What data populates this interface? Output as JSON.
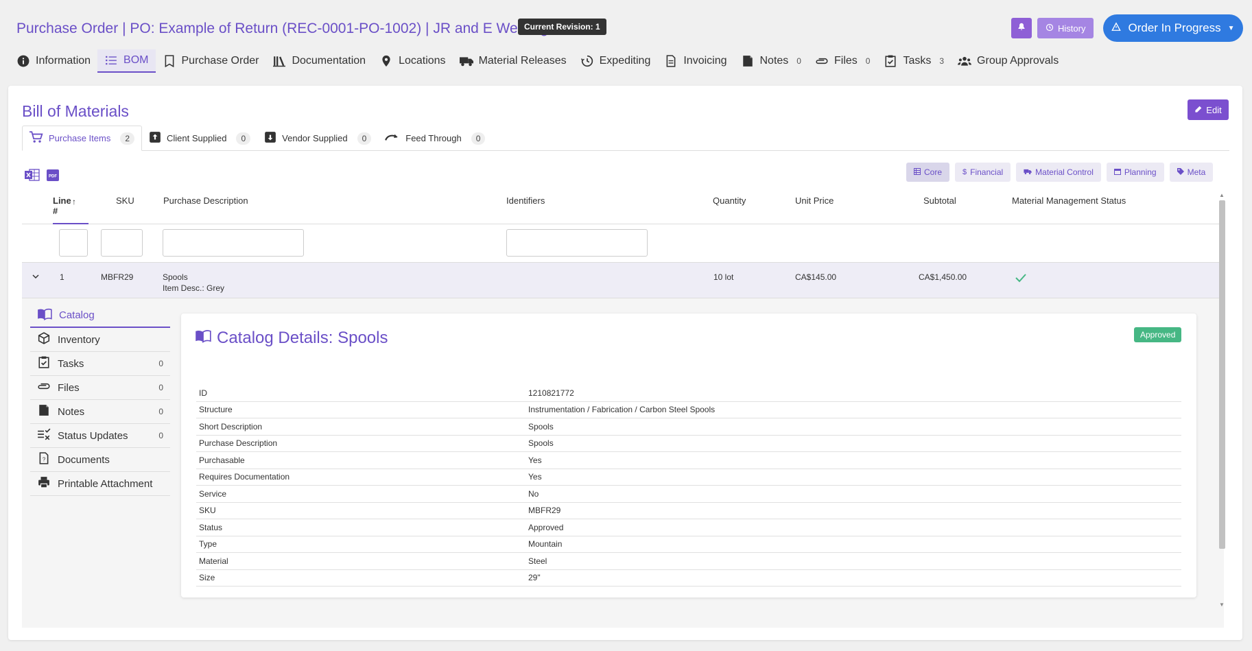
{
  "header": {
    "title": "Purchase Order | PO: Example of Return (REC-0001-PO-1002) | JR and E Welding",
    "revision_badge": "Current Revision: 1",
    "history_label": "History",
    "order_status_label": "Order In Progress"
  },
  "nav": [
    {
      "label": "Information",
      "icon": "info-icon"
    },
    {
      "label": "BOM",
      "icon": "list-icon",
      "active": true
    },
    {
      "label": "Purchase Order",
      "icon": "bookmark-icon"
    },
    {
      "label": "Documentation",
      "icon": "library-icon"
    },
    {
      "label": "Locations",
      "icon": "map-pin-icon"
    },
    {
      "label": "Material Releases",
      "icon": "truck-icon"
    },
    {
      "label": "Expediting",
      "icon": "clock-history-icon"
    },
    {
      "label": "Invoicing",
      "icon": "invoice-icon"
    },
    {
      "label": "Notes",
      "icon": "note-icon",
      "count": "0"
    },
    {
      "label": "Files",
      "icon": "paperclip-icon",
      "count": "0"
    },
    {
      "label": "Tasks",
      "icon": "checklist-icon",
      "count": "3"
    },
    {
      "label": "Group Approvals",
      "icon": "users-icon"
    }
  ],
  "bom": {
    "title": "Bill of Materials",
    "edit_label": "Edit",
    "subtabs": [
      {
        "label": "Purchase Items",
        "count": "2"
      },
      {
        "label": "Client Supplied",
        "count": "0"
      },
      {
        "label": "Vendor Supplied",
        "count": "0"
      },
      {
        "label": "Feed Through",
        "count": "0"
      }
    ],
    "view_buttons": [
      "Core",
      "Financial",
      "Material Control",
      "Planning",
      "Meta"
    ],
    "columns": {
      "line": "Line #",
      "sku": "SKU",
      "purchase_description": "Purchase Description",
      "identifiers": "Identifiers",
      "quantity": "Quantity",
      "unit_price": "Unit Price",
      "subtotal": "Subtotal",
      "mm_status": "Material Management Status"
    },
    "row": {
      "line": "1",
      "sku": "MBFR29",
      "description": "Spools",
      "item_desc": "Item Desc.: Grey",
      "quantity": "10 lot",
      "unit_price": "CA$145.00",
      "subtotal": "CA$1,450.00"
    }
  },
  "side_menu": [
    {
      "label": "Catalog",
      "icon": "book-icon",
      "active": true
    },
    {
      "label": "Inventory",
      "icon": "box-icon"
    },
    {
      "label": "Tasks",
      "icon": "checklist-icon",
      "count": "0"
    },
    {
      "label": "Files",
      "icon": "paperclip-icon",
      "count": "0"
    },
    {
      "label": "Notes",
      "icon": "note-icon",
      "count": "0"
    },
    {
      "label": "Status Updates",
      "icon": "status-list-icon",
      "count": "0"
    },
    {
      "label": "Documents",
      "icon": "document-icon"
    },
    {
      "label": "Printable Attachment",
      "icon": "printer-icon"
    }
  ],
  "catalog": {
    "title": "Catalog Details: Spools",
    "status_badge": "Approved",
    "details": [
      {
        "key": "ID",
        "value": "1210821772"
      },
      {
        "key": "Structure",
        "value": "Instrumentation / Fabrication / Carbon Steel Spools"
      },
      {
        "key": "Short Description",
        "value": "Spools"
      },
      {
        "key": "Purchase Description",
        "value": "Spools"
      },
      {
        "key": "Purchasable",
        "value": "Yes"
      },
      {
        "key": "Requires Documentation",
        "value": "Yes"
      },
      {
        "key": "Service",
        "value": "No"
      },
      {
        "key": "SKU",
        "value": "MBFR29"
      },
      {
        "key": "Status",
        "value": "Approved"
      },
      {
        "key": "Type",
        "value": "Mountain"
      },
      {
        "key": "Material",
        "value": "Steel"
      },
      {
        "key": "Size",
        "value": "29\""
      }
    ]
  },
  "colors": {
    "accent": "#6a4fc7",
    "primary_button": "#2f7ae0",
    "approved": "#46b784"
  }
}
